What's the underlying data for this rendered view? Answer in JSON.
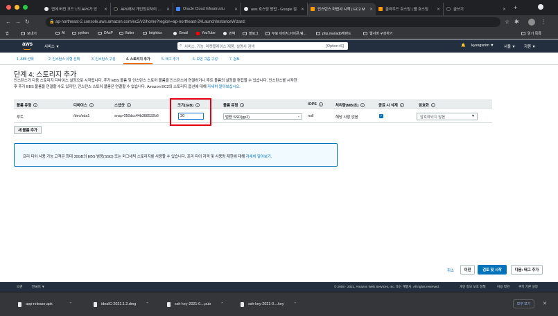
{
  "browser": {
    "tabs": [
      {
        "title": "앱에 버전 코드 1의 APK가 있",
        "favicon_color": "#e8eaed"
      },
      {
        "title": "APK에서 개인정보처리 방침",
        "favicon_color": "#1a1a1a"
      },
      {
        "title": "Oracle Cloud Infrastructu",
        "favicon_color": "#4285f4"
      },
      {
        "title": "aws 호스팅 방법 - Google 검",
        "favicon_color": "#e8eaed"
      },
      {
        "title": "인스턴스 마법사 시작 | EC2 M",
        "favicon_color": "#ff9900"
      },
      {
        "title": "클라우드 호스팅 | 웹 호스팅",
        "favicon_color": "#ff9900"
      },
      {
        "title": "글쓰기",
        "favicon_color": "#1a1a1a"
      }
    ],
    "url": "ap-northeast-2.console.aws.amazon.com/ec2/v2/home?region=ap-northeast-2#LaunchInstanceWizard:",
    "bookmarks": [
      "앱",
      "모내기",
      "AI",
      "python",
      "DAsP",
      "flutter",
      "brightics",
      "Gmail",
      "YouTube",
      "번역",
      "블로그",
      "무료 이미지,아이콘,템...",
      "php,mariadb케렌드",
      "웹서버 구성하기",
      "읽기 목록"
    ]
  },
  "aws": {
    "logo": "aws",
    "services": "서비스 ▼",
    "search_placeholder": "서비스, 기능, 마켓플레이스 제품, 설명서 검색",
    "search_shortcut": "[Option+S]",
    "user": "kyungsnim ▼",
    "region": "서울 ▼",
    "support": "지원 ▼"
  },
  "steps": [
    "1. AMI 선택",
    "2. 인스턴스 유형 선택",
    "3. 인스턴스 구성",
    "4. 스토리지 추가",
    "5. 태그 추가",
    "6. 보안 그룹 구성",
    "7. 검토"
  ],
  "page": {
    "title": "단계 4: 스토리지 추가",
    "desc1": "인스턴스가 다음 스토리지 디바이스 설정으로 시작됩니다. 추가 EBS 볼륨 및 인스턴스 스토어 볼륨을 인스턴스에 연결하거나 루트 볼륨의 설정을 편집할 수 있습니다. 인스턴스를 시작한",
    "desc2": "후 추가 EBS 볼륨을 연결할 수도 있지만, 인스턴스 스토어 볼륨은 연결할 수 없습니다. Amazon EC2의 스토리지 옵션에 대해 ",
    "desc_link": "자세히 알아보십시오."
  },
  "table": {
    "headers": [
      "볼륨 유형",
      "디바이스",
      "스냅샷",
      "크기(GiB)",
      "볼륨 유형",
      "IOPS",
      "처리량(MB/초)",
      "종료 시 삭제",
      "암호화"
    ],
    "row": {
      "volume_type": "루트",
      "device": "/dev/sda1",
      "snapshot": "snap-050dcc44b388532b6",
      "size": "30",
      "ebs_type": "범용 SSD(gp2)",
      "iops": "null",
      "throughput": "해당 사항 없음",
      "encryption": "암호화되지 않음"
    }
  },
  "add_volume": "새 볼륨 추가",
  "free_tier": {
    "text": "프리 티어 사용 가능 고객은 최대 30GB의 EBS 범용(SSD) 또는 마그네틱 스토리지를 사용할 수 있습니다. 프리 티어 자격 및 사용량 제한에 대해 ",
    "link": "자세히 알아보기."
  },
  "footer_buttons": {
    "cancel": "취소",
    "prev": "이전",
    "review": "검토 및 시작",
    "next": "다음: 태그 추가"
  },
  "aws_footer": {
    "feedback": "의견",
    "language": "한국어 ▼",
    "copyright": "© 2008 - 2021, Amazon Web Services, Inc. 또는 계열사. All rights reserved.",
    "privacy": "개인 정보 보호 정책",
    "terms": "이용 약관",
    "cookies": "쿠키 기본 설정"
  },
  "downloads": {
    "items": [
      "app-release.apk",
      "ideaIC-2021.1.2.dmg",
      "ssh-key-2021-0....pub",
      "ssh-key-2021-0....key"
    ],
    "show_all": "모두 보기"
  }
}
